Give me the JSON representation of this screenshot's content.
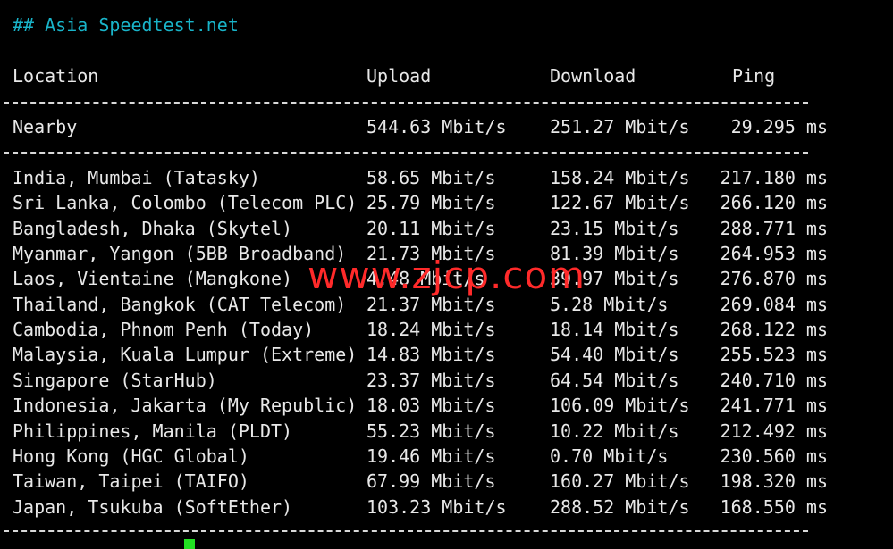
{
  "terminal": {
    "heading": "## Asia Speedtest.net",
    "columns": {
      "location": "Location",
      "upload": "Upload",
      "download": "Download",
      "ping": "Ping"
    },
    "nearby": {
      "location": "Nearby",
      "upload": "544.63 Mbit/s",
      "download": "251.27 Mbit/s",
      "ping": "29.295 ms"
    },
    "rows": [
      {
        "location": "India, Mumbai (Tatasky)",
        "upload": "58.65 Mbit/s",
        "download": "158.24 Mbit/s",
        "ping": "217.180 ms"
      },
      {
        "location": "Sri Lanka, Colombo (Telecom PLC)",
        "upload": "25.79 Mbit/s",
        "download": "122.67 Mbit/s",
        "ping": "266.120 ms"
      },
      {
        "location": "Bangladesh, Dhaka (Skytel)",
        "upload": "20.11 Mbit/s",
        "download": "23.15 Mbit/s",
        "ping": "288.771 ms"
      },
      {
        "location": "Myanmar, Yangon (5BB Broadband)",
        "upload": "21.73 Mbit/s",
        "download": "81.39 Mbit/s",
        "ping": "264.953 ms"
      },
      {
        "location": "Laos, Vientaine (Mangkone)",
        "upload": "4.48 Mbit/s",
        "download": "39.97 Mbit/s",
        "ping": "276.870 ms"
      },
      {
        "location": "Thailand, Bangkok (CAT Telecom)",
        "upload": "21.37 Mbit/s",
        "download": "5.28 Mbit/s",
        "ping": "269.084 ms"
      },
      {
        "location": "Cambodia, Phnom Penh (Today)",
        "upload": "18.24 Mbit/s",
        "download": "18.14 Mbit/s",
        "ping": "268.122 ms"
      },
      {
        "location": "Malaysia, Kuala Lumpur (Extreme)",
        "upload": "14.83 Mbit/s",
        "download": "54.40 Mbit/s",
        "ping": "255.523 ms"
      },
      {
        "location": "Singapore (StarHub)",
        "upload": "23.37 Mbit/s",
        "download": "64.54 Mbit/s",
        "ping": "240.710 ms"
      },
      {
        "location": "Indonesia, Jakarta (My Republic)",
        "upload": "18.03 Mbit/s",
        "download": "106.09 Mbit/s",
        "ping": "241.771 ms"
      },
      {
        "location": "Philippines, Manila (PLDT)",
        "upload": "55.23 Mbit/s",
        "download": "10.22 Mbit/s",
        "ping": "212.492 ms"
      },
      {
        "location": "Hong Kong (HGC Global)",
        "upload": "19.46 Mbit/s",
        "download": "0.70 Mbit/s",
        "ping": "230.560 ms"
      },
      {
        "location": "Taiwan, Taipei (TAIFO)",
        "upload": "67.99 Mbit/s",
        "download": "160.27 Mbit/s",
        "ping": "198.320 ms"
      },
      {
        "location": "Japan, Tsukuba (SoftEther)",
        "upload": "103.23 Mbit/s",
        "download": "288.52 Mbit/s",
        "ping": "168.550 ms"
      }
    ],
    "watermark": "www.zjcp.com",
    "colors": {
      "background": "#000000",
      "text": "#e8e8e8",
      "heading": "#19b4c9",
      "watermark": "#ff2a2a",
      "cursor": "#22e022"
    }
  }
}
